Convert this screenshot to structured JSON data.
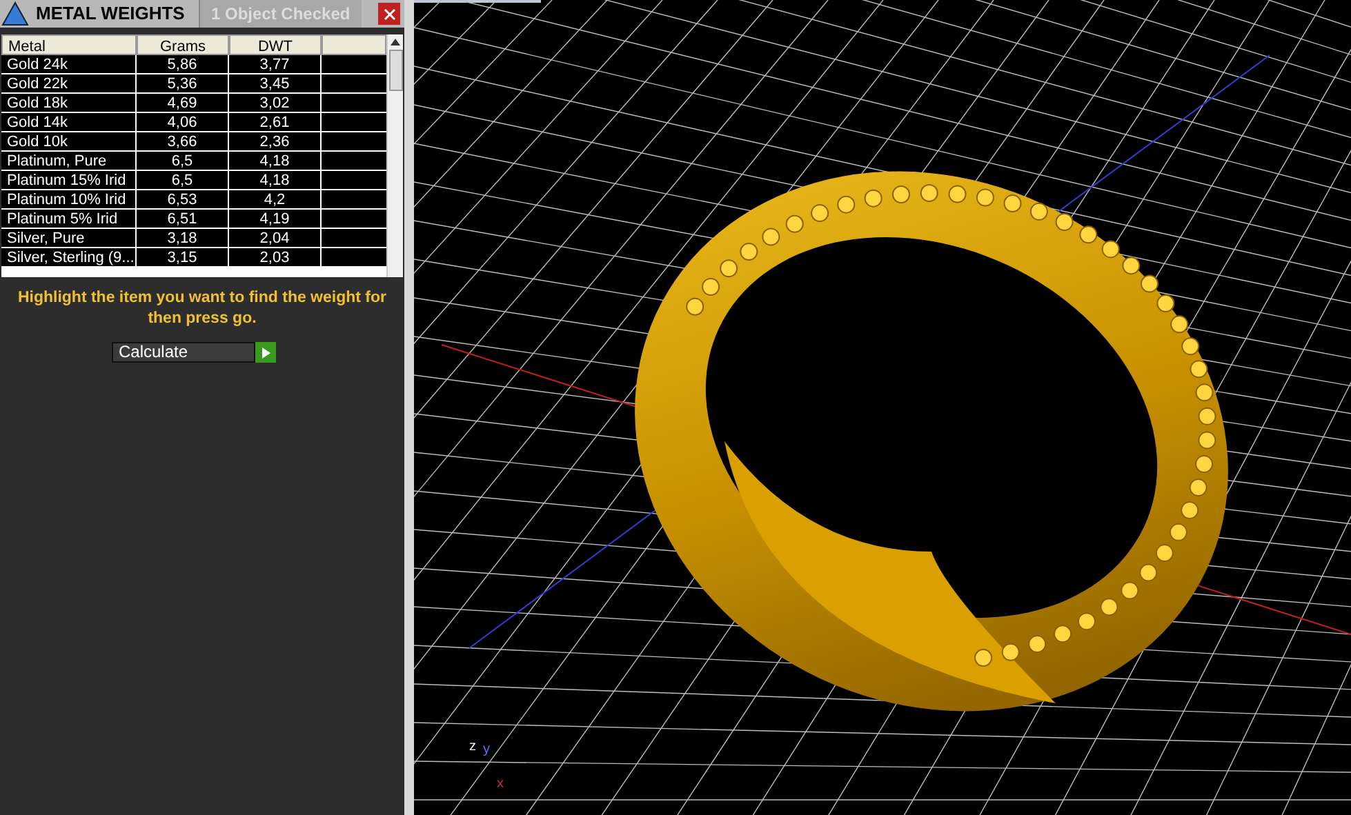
{
  "panel": {
    "title": "METAL WEIGHTS",
    "tabs": [
      {
        "label": "1 Object Checked",
        "selected": false
      }
    ]
  },
  "table": {
    "columns": [
      "Metal",
      "Grams",
      "DWT"
    ],
    "rows": [
      [
        "Gold 24k",
        "5,86",
        "3,77"
      ],
      [
        "Gold 22k",
        "5,36",
        "3,45"
      ],
      [
        "Gold 18k",
        "4,69",
        "3,02"
      ],
      [
        "Gold 14k",
        "4,06",
        "2,61"
      ],
      [
        "Gold 10k",
        "3,66",
        "2,36"
      ],
      [
        "Platinum, Pure",
        "6,5",
        "4,18"
      ],
      [
        "Platinum 15% Irid",
        "6,5",
        "4,18"
      ],
      [
        "Platinum 10% Irid",
        "6,53",
        "4,2"
      ],
      [
        "Platinum 5% Irid",
        "6,51",
        "4,19"
      ],
      [
        "Silver, Pure",
        "3,18",
        "2,04"
      ],
      [
        "Silver, Sterling (9...",
        "3,15",
        "2,03"
      ]
    ]
  },
  "instruction": "Highlight the item you want to find the weight for then press go.",
  "calculate": {
    "value": "Calculate"
  },
  "viewport": {
    "axes": [
      "z",
      "y",
      "x"
    ]
  }
}
